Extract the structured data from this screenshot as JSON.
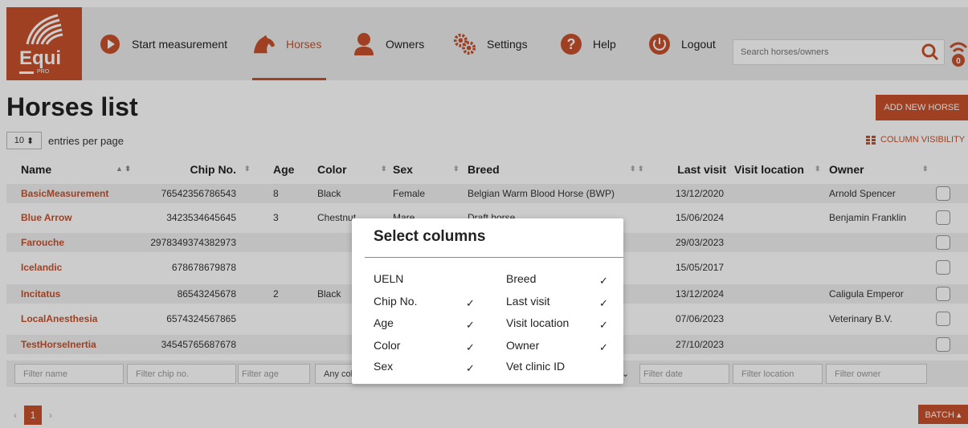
{
  "brand": {
    "word": "Equi",
    "sub": "PRO"
  },
  "nav": [
    {
      "label": "Start measurement",
      "icon": "play-icon"
    },
    {
      "label": "Horses",
      "icon": "horse-icon",
      "active": true
    },
    {
      "label": "Owners",
      "icon": "person-icon"
    },
    {
      "label": "Settings",
      "icon": "gears-icon"
    },
    {
      "label": "Help",
      "icon": "help-icon"
    },
    {
      "label": "Logout",
      "icon": "power-icon"
    }
  ],
  "search": {
    "placeholder": "Search horses/owners"
  },
  "page": {
    "title": "Horses list",
    "add_button": "ADD NEW HORSE",
    "entries_value": "10",
    "entries_label": "entries per page",
    "column_visibility": "COLUMN VISIBILITY"
  },
  "table": {
    "headers": {
      "name": "Name",
      "chip": "Chip No.",
      "age": "Age",
      "color": "Color",
      "sex": "Sex",
      "breed": "Breed",
      "last_visit": "Last visit",
      "visit_location": "Visit location",
      "owner": "Owner"
    },
    "rows": [
      {
        "name": "BasicMeasurement",
        "chip": "76542356786543",
        "age": "8",
        "color": "Black",
        "sex": "Female",
        "breed": "Belgian Warm Blood Horse (BWP)",
        "last_visit": "13/12/2020",
        "visit_location": "",
        "owner": "Arnold Spencer"
      },
      {
        "name": "Blue Arrow",
        "chip": "3423534645645",
        "age": "3",
        "color": "Chestnut",
        "sex": "Mare",
        "breed": "Draft horse",
        "last_visit": "15/06/2024",
        "visit_location": "",
        "owner": "Benjamin Franklin"
      },
      {
        "name": "Farouche",
        "chip": "2978349374382973",
        "age": "",
        "color": "",
        "sex": "",
        "breed": "",
        "last_visit": "29/03/2023",
        "visit_location": "",
        "owner": ""
      },
      {
        "name": "Icelandic",
        "chip": "678678679878",
        "age": "",
        "color": "",
        "sex": "",
        "breed": "",
        "last_visit": "15/05/2017",
        "visit_location": "",
        "owner": ""
      },
      {
        "name": "Incitatus",
        "chip": "86543245678",
        "age": "2",
        "color": "Black",
        "sex": "",
        "breed": "",
        "last_visit": "13/12/2024",
        "visit_location": "",
        "owner": "Caligula Emperor"
      },
      {
        "name": "LocalAnesthesia",
        "chip": "6574324567865",
        "age": "",
        "color": "",
        "sex": "",
        "breed": "",
        "last_visit": "07/06/2023",
        "visit_location": "",
        "owner": "Veterinary B.V."
      },
      {
        "name": "TestHorseInertia",
        "chip": "34545765687678",
        "age": "",
        "color": "",
        "sex": "",
        "breed": "",
        "last_visit": "27/10/2023",
        "visit_location": "",
        "owner": ""
      }
    ],
    "filters": {
      "name": "Filter name",
      "chip": "Filter chip no.",
      "age": "Filter age",
      "color": "Any col",
      "date": "Filter date",
      "location": "Filter location",
      "owner": "Filter owner"
    }
  },
  "pagination": {
    "prev": "‹",
    "current": "1",
    "next": "›"
  },
  "batch": "BATCH ▴",
  "modal": {
    "title": "Select columns",
    "left": [
      {
        "label": "UELN",
        "checked": ""
      },
      {
        "label": "Chip No.",
        "checked": "✓"
      },
      {
        "label": "Age",
        "checked": "✓"
      },
      {
        "label": "Color",
        "checked": "✓"
      },
      {
        "label": "Sex",
        "checked": "✓"
      }
    ],
    "right": [
      {
        "label": "Breed",
        "checked": "✓"
      },
      {
        "label": "Last visit",
        "checked": "✓"
      },
      {
        "label": "Visit location",
        "checked": "✓"
      },
      {
        "label": "Owner",
        "checked": "✓"
      },
      {
        "label": "Vet clinic ID",
        "checked": ""
      }
    ]
  },
  "colors": {
    "accent": "#c7512b"
  }
}
